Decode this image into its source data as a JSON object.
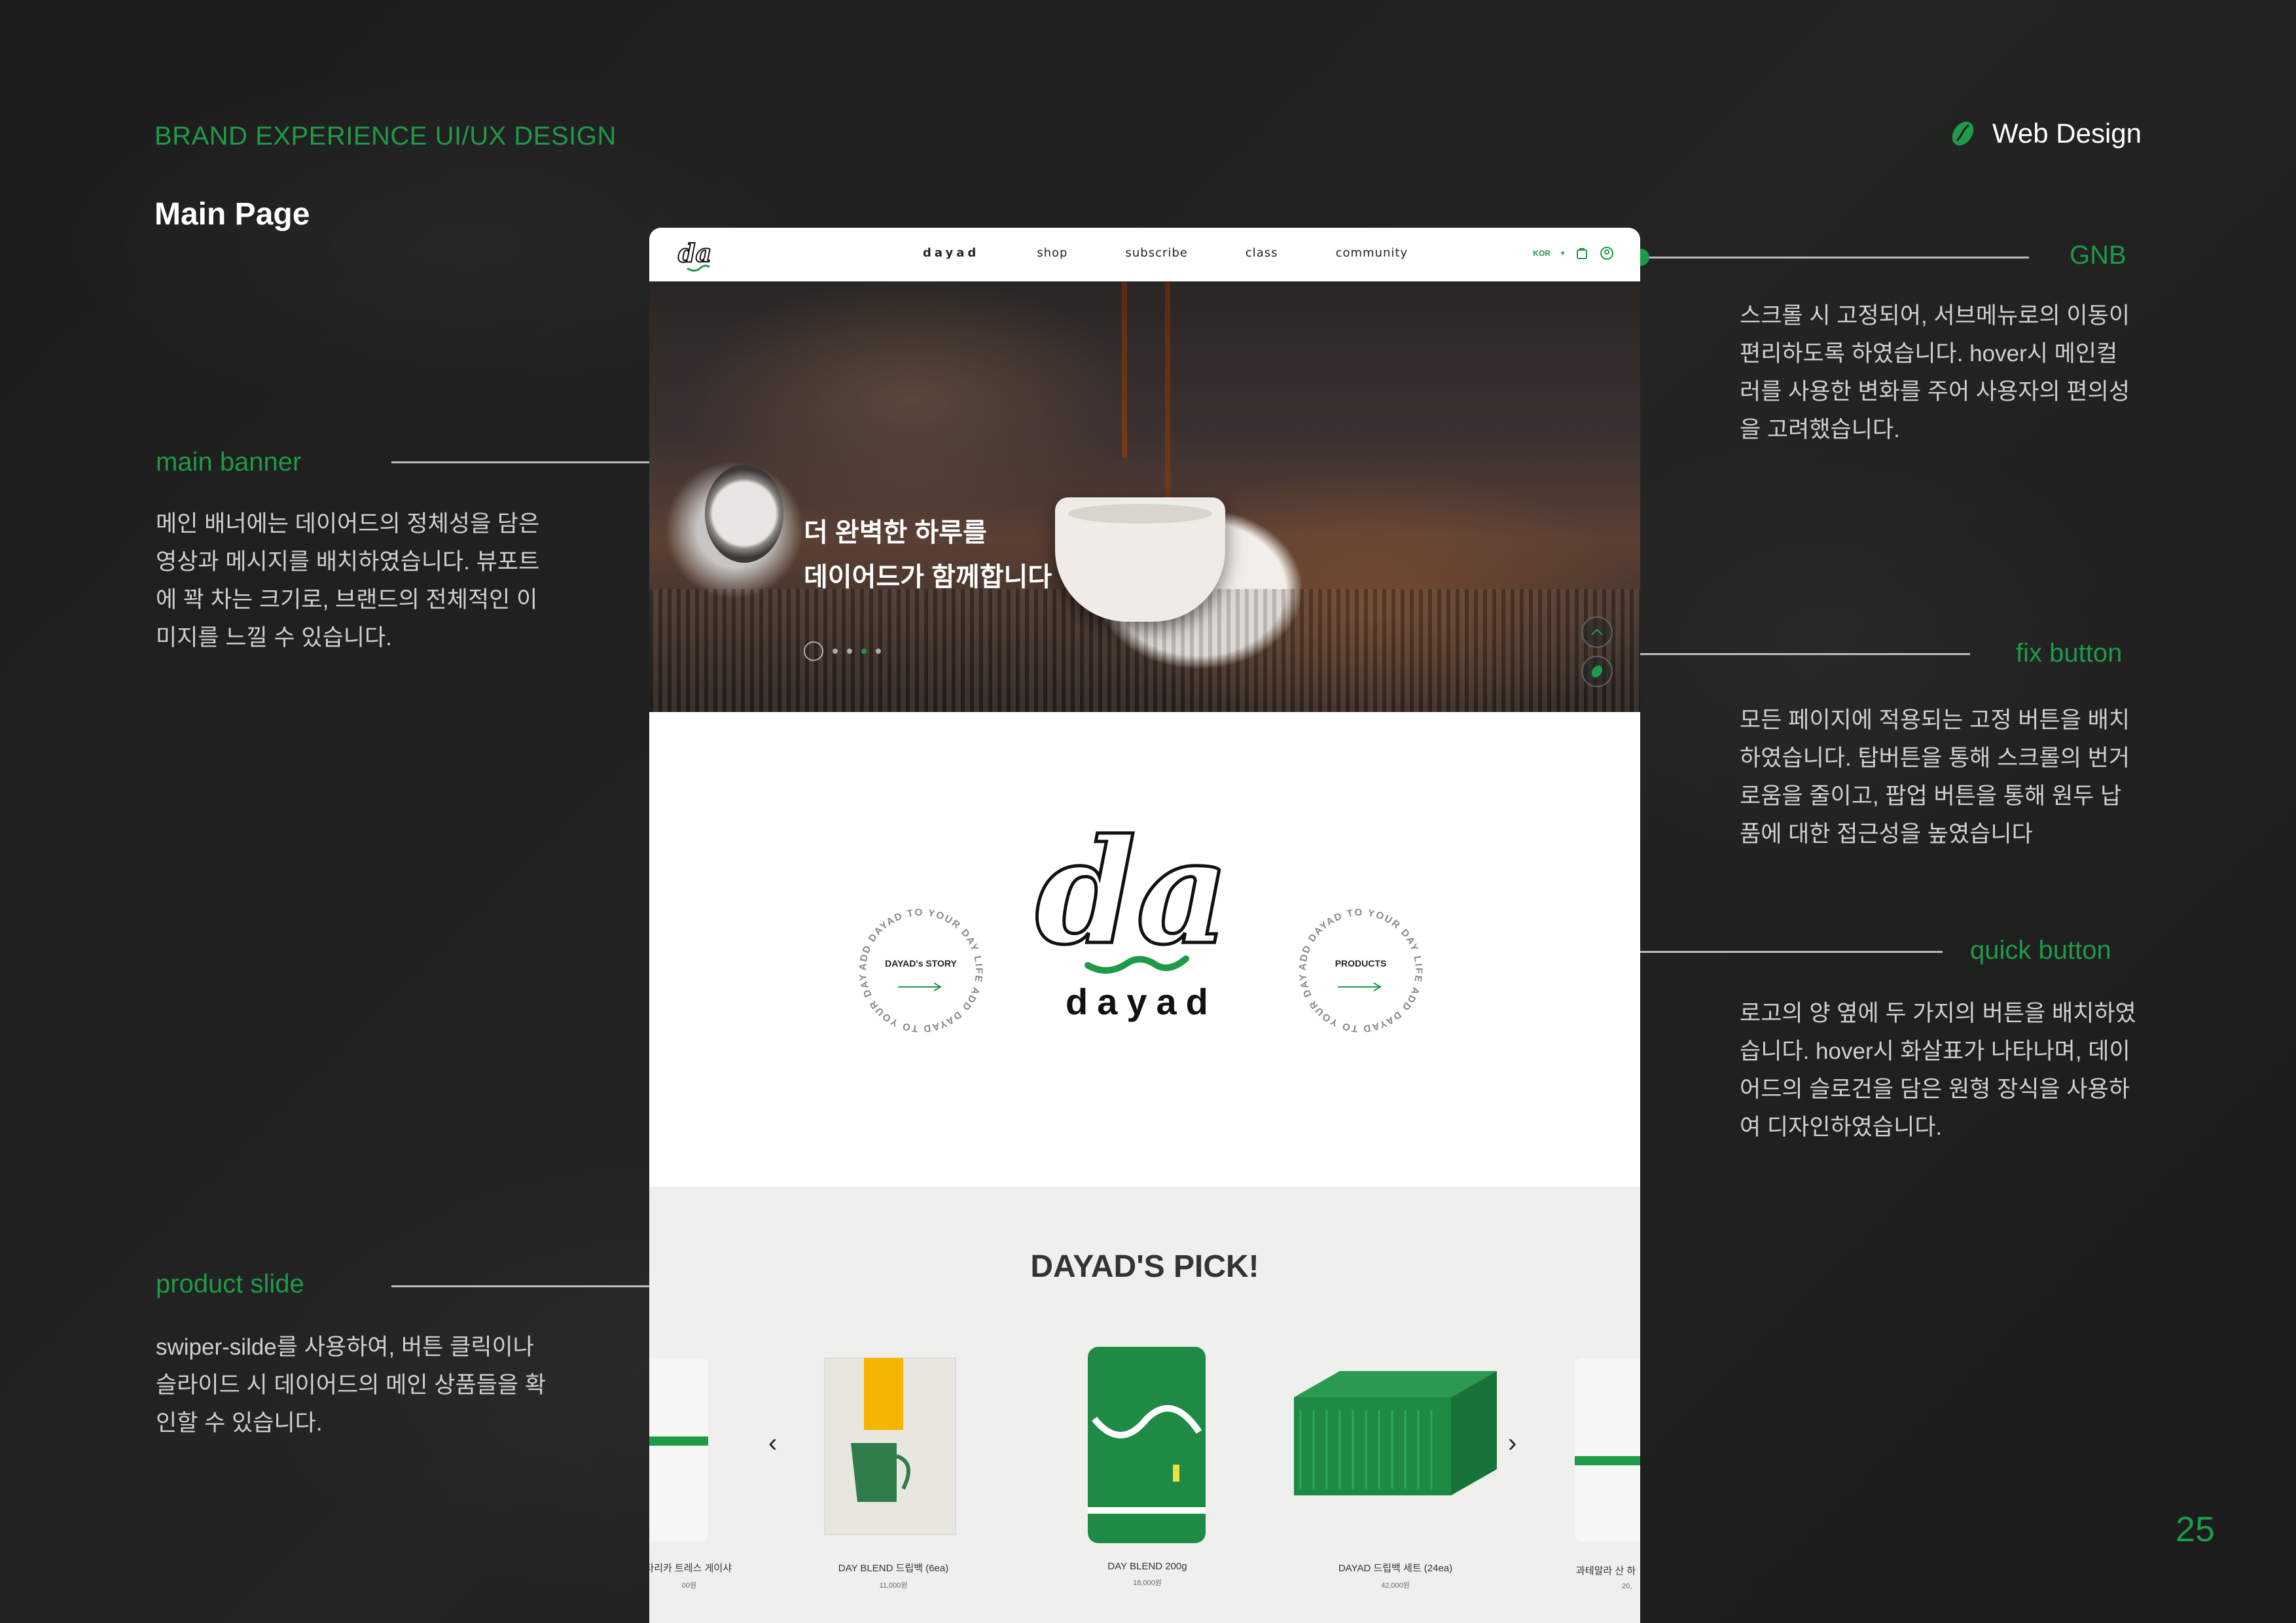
{
  "header": {
    "category": "BRAND EXPERIENCE UI/UX DESIGN",
    "page_title": "Main Page",
    "section": "Web Design",
    "page_number": "25"
  },
  "annotations": {
    "gnb": {
      "title": "GNB",
      "desc": "스크롤 시 고정되어, 서브메뉴로의 이동이\n편리하도록 하였습니다. hover시 메인컬\n러를 사용한 변화를 주어 사용자의 편의성\n을 고려했습니다."
    },
    "main_banner": {
      "title": "main banner",
      "desc": "메인 배너에는 데이어드의 정체성을 담은\n영상과 메시지를 배치하였습니다. 뷰포트\n에 꽉 차는 크기로, 브랜드의 전체적인 이\n미지를 느낄  수 있습니다."
    },
    "fix_button": {
      "title": "fix button",
      "desc": "모든 페이지에 적용되는 고정 버튼을 배치\n하였습니다. 탑버튼을 통해 스크롤의 번거\n로움을 줄이고, 팝업 버튼을 통해 원두 납\n품에 대한 접근성을 높였습니다"
    },
    "quick_button": {
      "title": "quick button",
      "desc": "로고의 양 옆에 두 가지의 버튼을 배치하였\n습니다. hover시 화살표가 나타나며, 데이\n어드의 슬로건을 담은 원형 장식을 사용하\n여 디자인하였습니다."
    },
    "product_slide": {
      "title": "product slide",
      "desc": "swiper-silde를 사용하여, 버튼 클릭이나\n슬라이드 시 데이어드의 메인 상품들을 확\n인할 수 있습니다."
    }
  },
  "site": {
    "nav": {
      "brand": "dayad",
      "items": [
        "shop",
        "subscribe",
        "class",
        "community"
      ],
      "lang": "KOR"
    },
    "banner": {
      "headline": "더 완벽한 하루를\n데이어드가 함께합니다",
      "slides": 4,
      "active_slide": 3
    },
    "logo_section": {
      "wordmark": "dayad",
      "left_button": "DAYAD's STORY",
      "right_button": "PRODUCTS",
      "ring_text": "ADD DAYAD TO YOUR DAY LIFE ADD DAYAD TO YOUR DAY LIFE "
    },
    "pick": {
      "title": "DAYAD'S PICK!",
      "products": [
        {
          "name": "코스타리카 트레스 게이샤",
          "price": "00원"
        },
        {
          "name": "DAY BLEND 드립백 (6ea)",
          "price": "11,000원"
        },
        {
          "name": "DAY BLEND 200g",
          "price": "18,000원"
        },
        {
          "name": "DAYAD 드립백 세트 (24ea)",
          "price": "42,000원"
        },
        {
          "name": "과테말라 산 하",
          "price": "20,"
        }
      ]
    }
  },
  "colors": {
    "accent": "#1f9a47",
    "background": "#1d1e1d",
    "text_light": "#cfd0cf"
  }
}
